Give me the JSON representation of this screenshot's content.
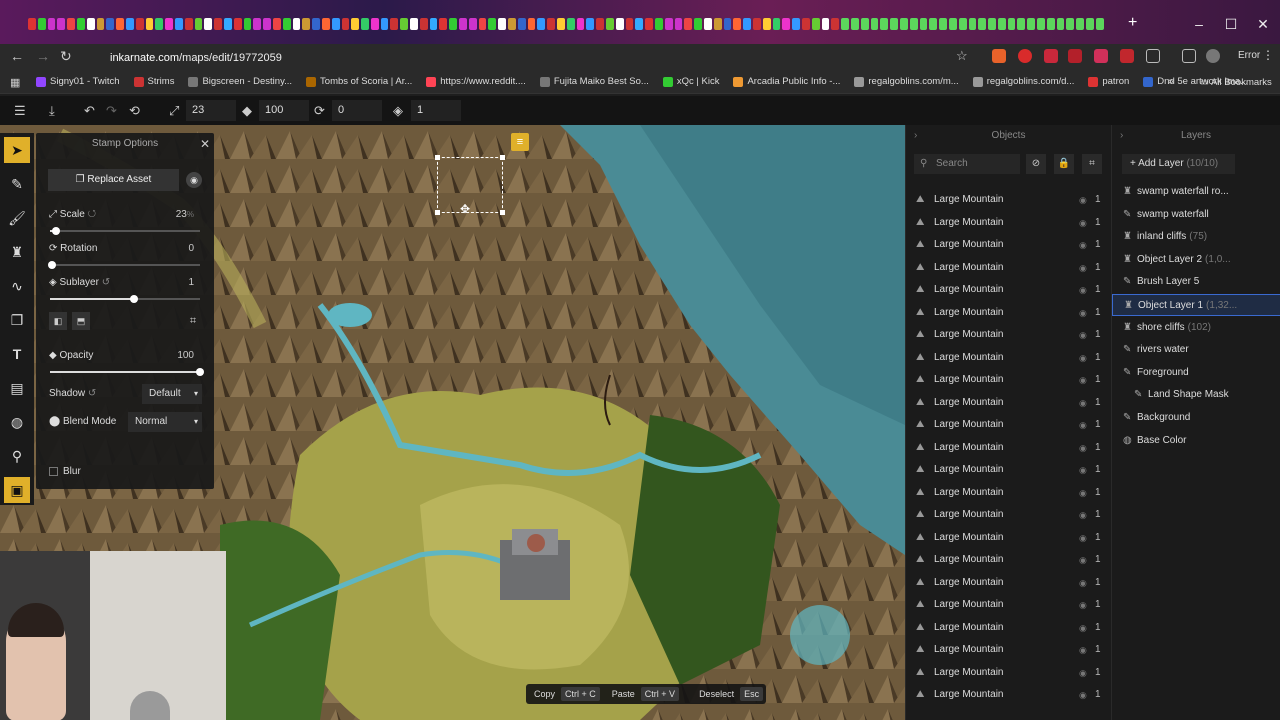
{
  "browser": {
    "url_host": "inkarnate.com",
    "url_path": "/maps/edit/19772059",
    "bookmarks": [
      "Signy01 - Twitch",
      "Strims",
      "Bigscreen - Destiny...",
      "Tombs of Scoria | Ar...",
      "https://www.reddit....",
      "Fujita Maiko Best So...",
      "xQc | Kick",
      "Arcadia Public Info -...",
      "regalgoblins.com/m...",
      "regalgoblins.com/d...",
      "patron",
      "Dnd 5e artwork Ima..."
    ],
    "all_bookmarks": "All Bookmarks",
    "profile": "Error"
  },
  "toolbar": {
    "size_value": "23",
    "opacity_value": "100",
    "rotation_value": "0",
    "layer_value": "1"
  },
  "stamp_options": {
    "title": "Stamp Options",
    "replace_asset": "Replace Asset",
    "scale_label": "Scale",
    "scale_value": "23",
    "scale_unit": "%",
    "rotation_label": "Rotation",
    "rotation_value": "0",
    "sublayer_label": "Sublayer",
    "sublayer_value": "1",
    "opacity_label": "Opacity",
    "opacity_value": "100",
    "shadow_label": "Shadow",
    "shadow_value": "Default",
    "blend_label": "Blend Mode",
    "blend_value": "Normal",
    "blur_label": "Blur"
  },
  "objects": {
    "title": "Objects",
    "search_placeholder": "Search",
    "items": [
      {
        "name": "Large Mountain",
        "count": "1"
      },
      {
        "name": "Large Mountain",
        "count": "1"
      },
      {
        "name": "Large Mountain",
        "count": "1"
      },
      {
        "name": "Large Mountain",
        "count": "1"
      },
      {
        "name": "Large Mountain",
        "count": "1"
      },
      {
        "name": "Large Mountain",
        "count": "1"
      },
      {
        "name": "Large Mountain",
        "count": "1"
      },
      {
        "name": "Large Mountain",
        "count": "1"
      },
      {
        "name": "Large Mountain",
        "count": "1"
      },
      {
        "name": "Large Mountain",
        "count": "1"
      },
      {
        "name": "Large Mountain",
        "count": "1"
      },
      {
        "name": "Large Mountain",
        "count": "1"
      },
      {
        "name": "Large Mountain",
        "count": "1"
      },
      {
        "name": "Large Mountain",
        "count": "1"
      },
      {
        "name": "Large Mountain",
        "count": "1"
      },
      {
        "name": "Large Mountain",
        "count": "1"
      },
      {
        "name": "Large Mountain",
        "count": "1"
      },
      {
        "name": "Large Mountain",
        "count": "1"
      },
      {
        "name": "Large Mountain",
        "count": "1"
      },
      {
        "name": "Large Mountain",
        "count": "1"
      },
      {
        "name": "Large Mountain",
        "count": "1"
      },
      {
        "name": "Large Mountain",
        "count": "1"
      },
      {
        "name": "Large Mountain",
        "count": "1"
      }
    ]
  },
  "layers": {
    "title": "Layers",
    "add_layer": "Add Layer",
    "add_layer_count": "(10/10)",
    "items": [
      {
        "name": "swamp waterfall ro...",
        "count": "",
        "icon": "object"
      },
      {
        "name": "swamp waterfall",
        "count": "",
        "icon": "brush"
      },
      {
        "name": "inland cliffs",
        "count": "(75)",
        "icon": "object"
      },
      {
        "name": "Object Layer 2",
        "count": "(1,0...",
        "icon": "object"
      },
      {
        "name": "Brush Layer 5",
        "count": "",
        "icon": "brush"
      },
      {
        "name": "Object Layer 1",
        "count": "(1,32...",
        "icon": "object"
      },
      {
        "name": "shore cliffs",
        "count": "(102)",
        "icon": "object"
      },
      {
        "name": "rivers water",
        "count": "",
        "icon": "brush"
      },
      {
        "name": "Foreground",
        "count": "",
        "icon": "brush"
      },
      {
        "name": "Land Shape Mask",
        "count": "",
        "icon": "brush"
      },
      {
        "name": "Background",
        "count": "",
        "icon": "brush"
      },
      {
        "name": "Base Color",
        "count": "",
        "icon": "palette"
      }
    ]
  },
  "bottom_bar": {
    "copy": "Copy",
    "copy_key": "Ctrl + C",
    "paste": "Paste",
    "paste_key": "Ctrl + V",
    "deselect": "Deselect",
    "deselect_key": "Esc"
  }
}
